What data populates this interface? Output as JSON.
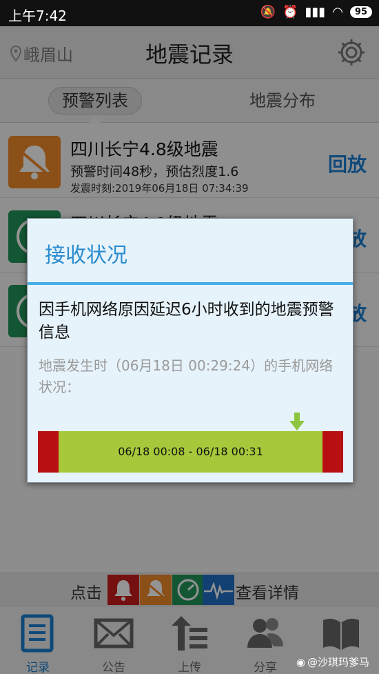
{
  "status_bar": {
    "time": "上午7:42",
    "battery": "95"
  },
  "header": {
    "location": "峨眉山",
    "title": "地震记录"
  },
  "tabs": [
    {
      "label": "预警列表"
    },
    {
      "label": "地震分布"
    }
  ],
  "records": [
    {
      "title": "四川长宁4.8级地震",
      "detail": "预警时间48秒，预估烈度1.6",
      "time": "发震时刻:2019年06月18日 07:34:39",
      "action": "回放",
      "icon": "bell-icon",
      "color": "#ef8b2a"
    },
    {
      "title": "四川长宁4.1级地震",
      "action": "放",
      "icon": "clock-icon",
      "color": "#22945a"
    },
    {
      "action": "放",
      "icon": "clock-icon",
      "color": "#22945a"
    }
  ],
  "hint": {
    "prefix": "点击",
    "suffix": "查看详情"
  },
  "nav": [
    {
      "label": "记录",
      "icon": "record-icon",
      "active": true
    },
    {
      "label": "公告",
      "icon": "mail-icon"
    },
    {
      "label": "上传",
      "icon": "upload-icon"
    },
    {
      "label": "分享",
      "icon": "people-icon"
    },
    {
      "label": "",
      "icon": "book-icon"
    }
  ],
  "dialog": {
    "title": "接收状况",
    "message": "因手机网络原因延迟6小时收到的地震预警信息",
    "sub": "地震发生时（06月18日 00:29:24）的手机网络状况：",
    "timeline_label": "06/18 00:08 - 06/18 00:31"
  },
  "watermark": "@沙琪玛爹马",
  "colors": {
    "accent": "#1a7fd3",
    "dialog_title": "#2a8bcf",
    "bar": "#a6c83a",
    "bar_edge": "#b80f13"
  }
}
